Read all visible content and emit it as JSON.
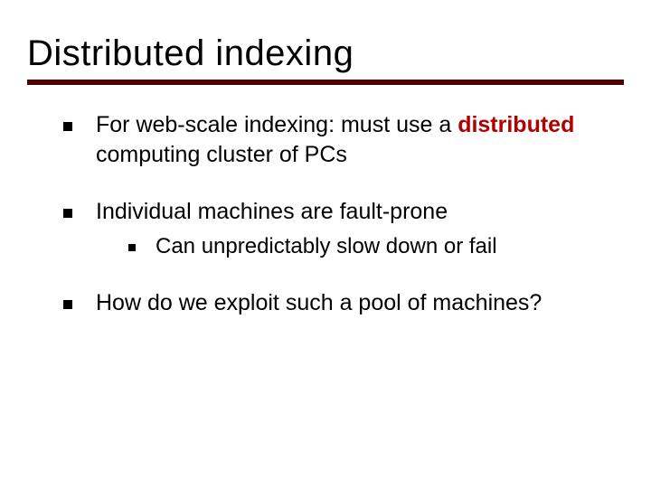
{
  "slide": {
    "title": "Distributed indexing",
    "bullets": [
      {
        "pre": "For web-scale indexing: must use a ",
        "hl": "distributed",
        "post": " computing cluster of PCs",
        "subs": []
      },
      {
        "pre": "Individual machines are fault-prone",
        "hl": "",
        "post": "",
        "subs": [
          {
            "text": "Can unpredictably slow down or fail"
          }
        ]
      },
      {
        "pre": "How do we exploit such a pool of machines?",
        "hl": "",
        "post": "",
        "subs": []
      }
    ]
  }
}
